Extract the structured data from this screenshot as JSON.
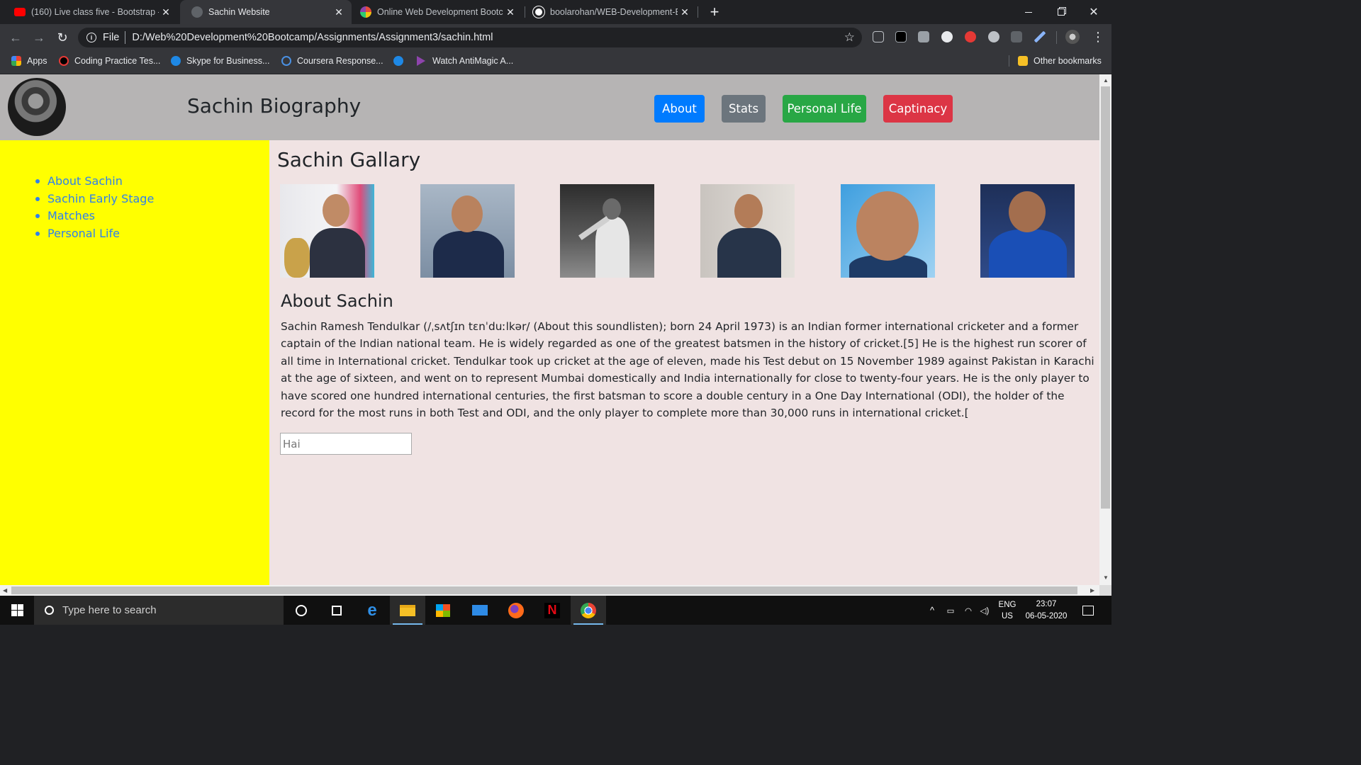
{
  "browser": {
    "tabs": [
      {
        "title": "(160) Live class five - Bootstrap -",
        "favicon_color": "#ff0000",
        "favicon": "youtube-icon"
      },
      {
        "title": "Sachin Website",
        "favicon_color": "#5f6368",
        "favicon": "globe-icon"
      },
      {
        "title": "Online Web Development Bootca",
        "favicon_color": "#8e44ad",
        "favicon": "course-icon"
      },
      {
        "title": "boolarohan/WEB-Development-B",
        "favicon_color": "#ffffff",
        "favicon": "github-icon"
      }
    ],
    "new_tab_label": "+",
    "address": {
      "scheme_label": "File",
      "url": "D:/Web%20Development%20Bootcamp/Assignments/Assignment3/sachin.html"
    },
    "bookmarks": [
      {
        "label": "Apps",
        "icon": "apps-grid-icon"
      },
      {
        "label": "Coding Practice Tes...",
        "icon": "coding-icon"
      },
      {
        "label": "Skype for Business...",
        "icon": "skype-icon"
      },
      {
        "label": "Coursera Response...",
        "icon": "coursera-icon"
      },
      {
        "label": "",
        "icon": "skype-icon"
      },
      {
        "label": "Watch AntiMagic A...",
        "icon": "play-icon"
      }
    ],
    "other_bookmarks": "Other bookmarks"
  },
  "site": {
    "title": "Sachin Biography",
    "nav": [
      {
        "label": "About",
        "color": "#007bff"
      },
      {
        "label": "Stats",
        "color": "#6c757d"
      },
      {
        "label": "Personal Life",
        "color": "#28a745"
      },
      {
        "label": "Captinacy",
        "color": "#dc3545"
      }
    ],
    "sidebar_links": [
      "About Sachin",
      "Sachin Early Stage",
      "Matches",
      "Personal Life"
    ],
    "gallery_heading": "Sachin Gallary",
    "about_heading": "About Sachin",
    "about_text": "Sachin Ramesh Tendulkar (/ˌsʌtʃɪn tɛnˈduːlkər/ (About this soundlisten); born 24 April 1973) is an Indian former international cricketer and a former captain of the Indian national team. He is widely regarded as one of the greatest batsmen in the history of cricket.[5] He is the highest run scorer of all time in International cricket. Tendulkar took up cricket at the age of eleven, made his Test debut on 15 November 1989 against Pakistan in Karachi at the age of sixteen, and went on to represent Mumbai domestically and India internationally for close to twenty-four years. He is the only player to have scored one hundred international centuries, the first batsman to score a double century in a One Day International (ODI), the holder of the record for the most runs in both Test and ODI, and the only player to complete more than 30,000 runs in international cricket.[",
    "input_placeholder": "Hai",
    "colors": {
      "header": "#b6b4b4",
      "sidebar": "#ffff00",
      "main": "#f0e3e3",
      "link": "#2f80ed"
    }
  },
  "taskbar": {
    "search_placeholder": "Type here to search",
    "lang_top": "ENG",
    "lang_bottom": "US",
    "time": "23:07",
    "date": "06-05-2020"
  }
}
